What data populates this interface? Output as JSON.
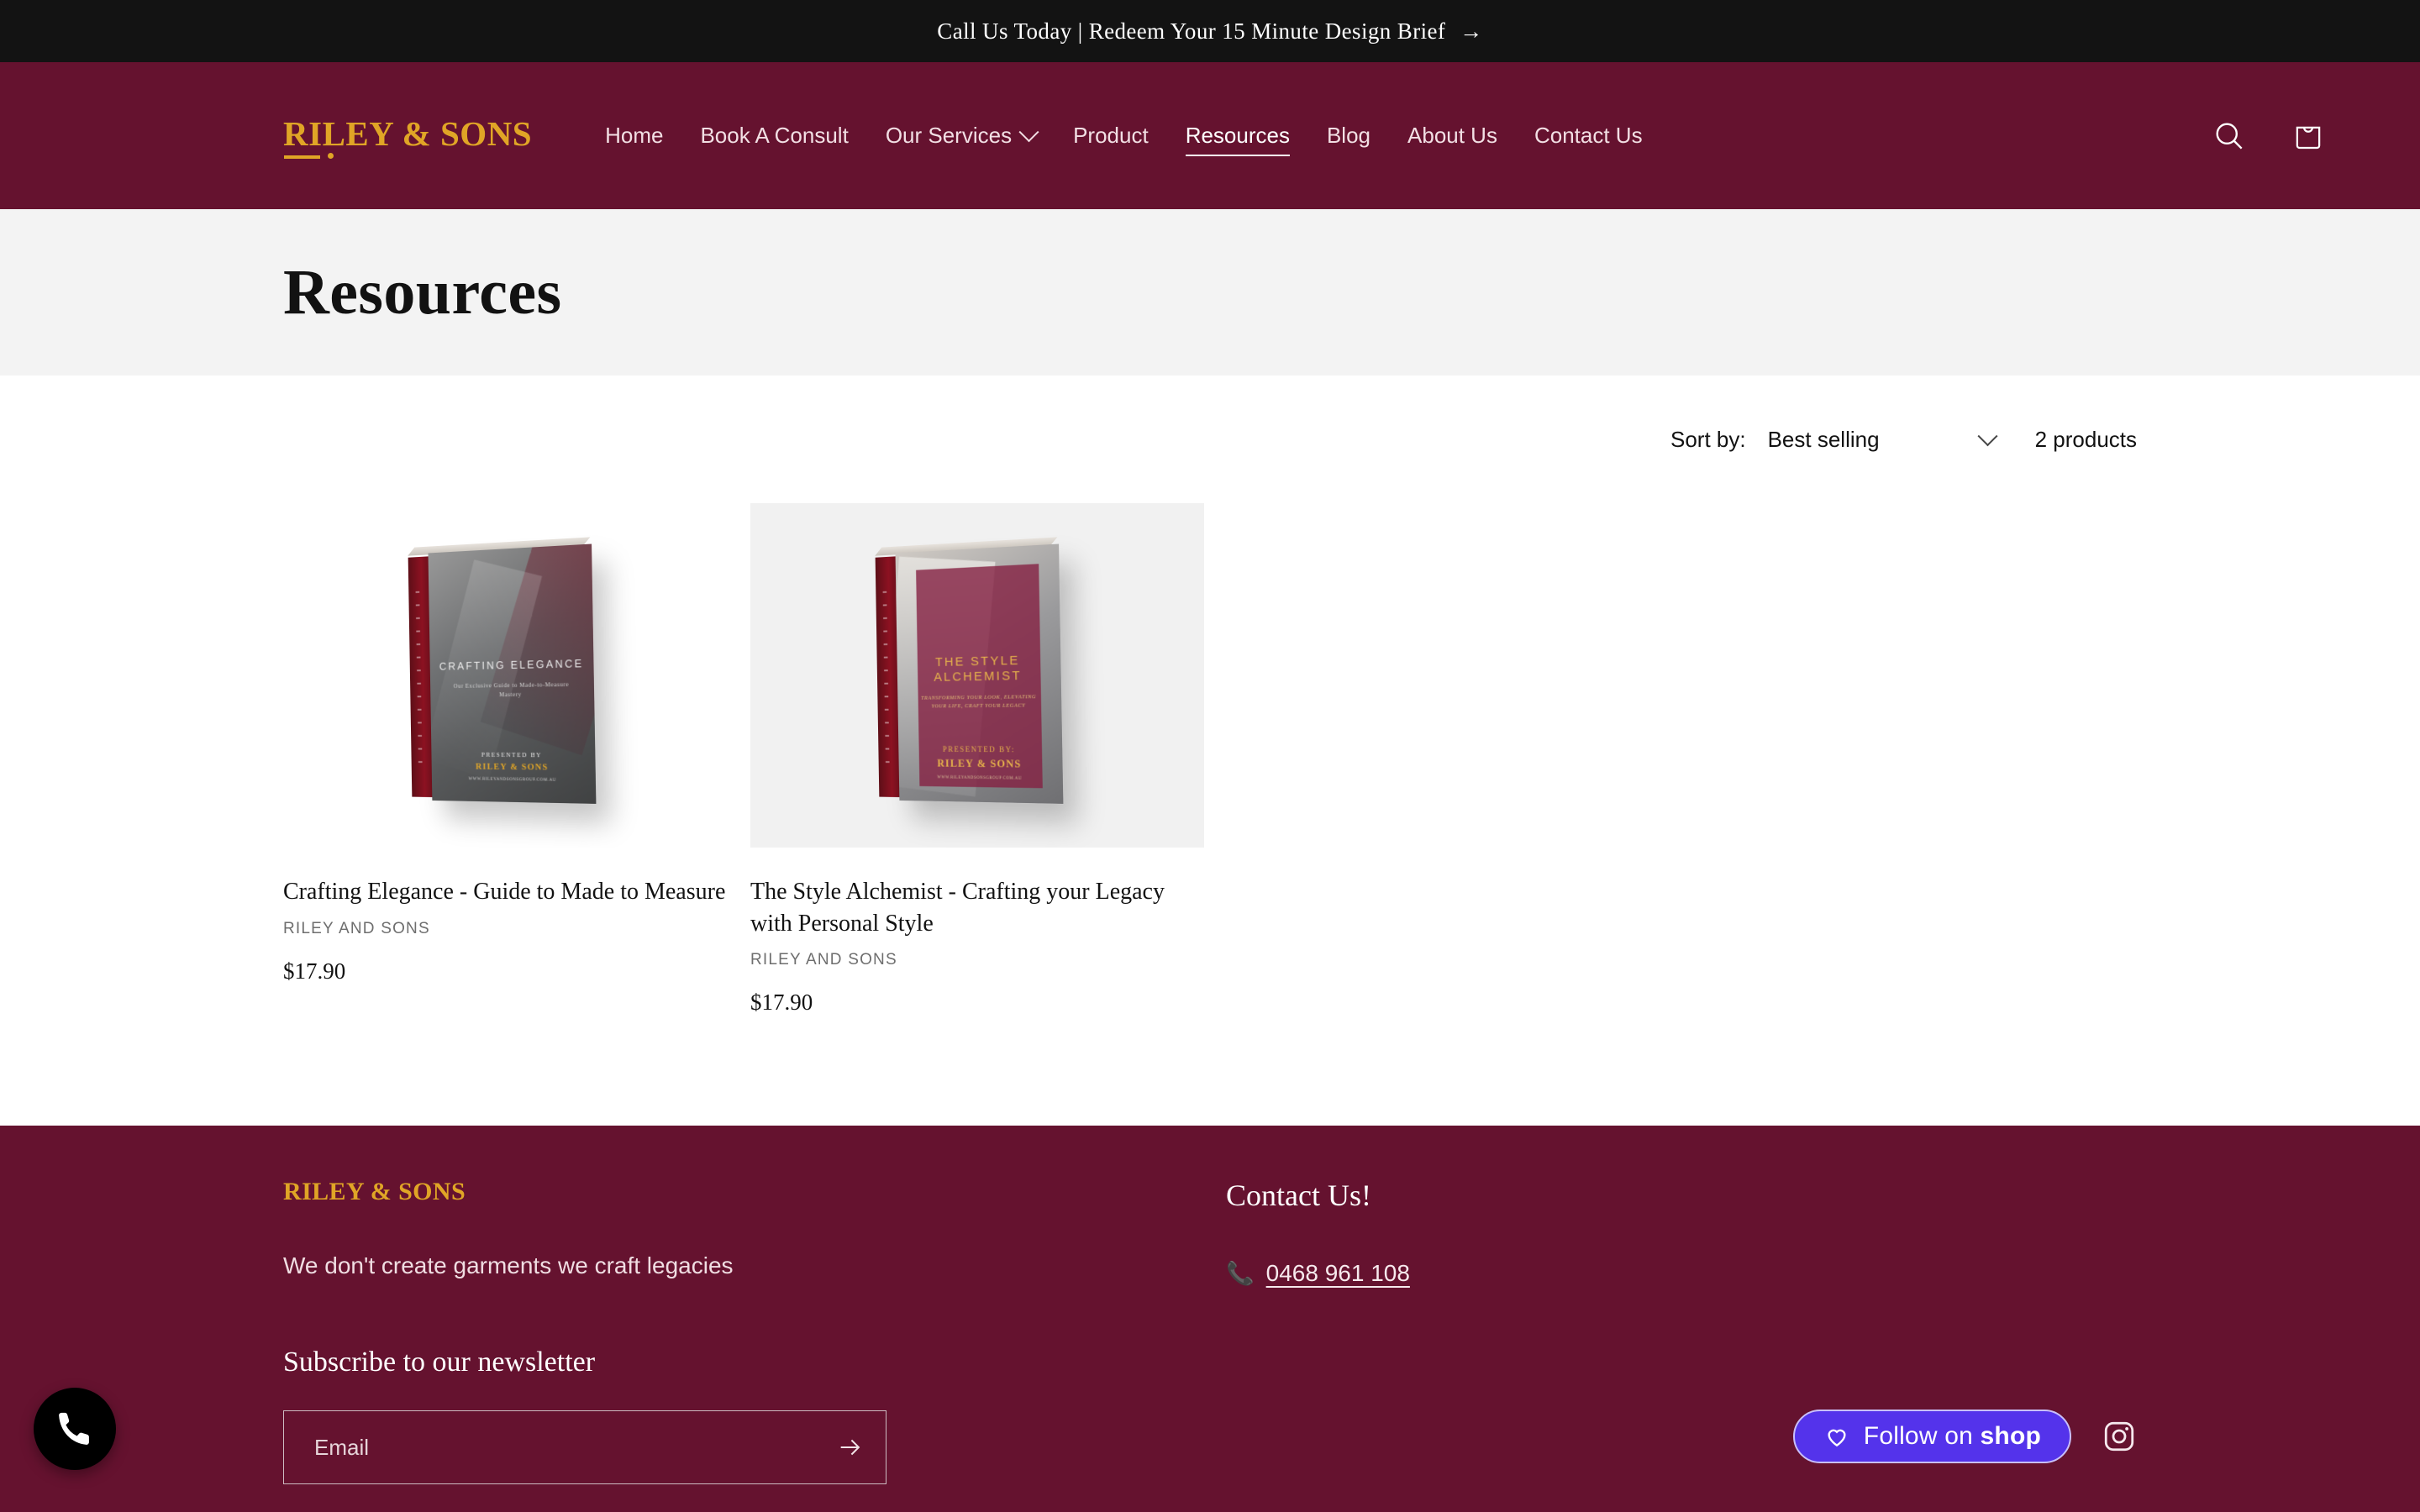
{
  "announcement": {
    "text": "Call Us Today | Redeem Your 15 Minute Design Brief",
    "arrow": "→"
  },
  "header": {
    "logo": "RILEY & SONS",
    "nav": [
      {
        "label": "Home",
        "has_chevron": false,
        "active": false
      },
      {
        "label": "Book A Consult",
        "has_chevron": false,
        "active": false
      },
      {
        "label": "Our Services",
        "has_chevron": true,
        "active": false
      },
      {
        "label": "Product",
        "has_chevron": false,
        "active": false
      },
      {
        "label": "Resources",
        "has_chevron": false,
        "active": true
      },
      {
        "label": "Blog",
        "has_chevron": false,
        "active": false
      },
      {
        "label": "About Us",
        "has_chevron": false,
        "active": false
      },
      {
        "label": "Contact Us",
        "has_chevron": false,
        "active": false
      }
    ],
    "search_icon": "search-icon",
    "cart_icon": "cart-bag-icon",
    "background_color": "#65122f",
    "accent_gold": "#e0a526"
  },
  "page": {
    "title": "Resources",
    "band_color": "#f3f3f3"
  },
  "toolbar": {
    "sort_label": "Sort by:",
    "sort_value": "Best selling",
    "product_count": "2 products"
  },
  "products": [
    {
      "title": "Crafting Elegance - Guide to Made to Measure",
      "vendor": "RILEY AND SONS",
      "price": "$17.90",
      "cover": {
        "title": "CRAFTING ELEGANCE",
        "subtitle": "Our Exclusive Guide to Made-to-Measure Mastery",
        "presented": "PRESENTED BY",
        "brand": "RILEY & SONS",
        "url": "WWW.RILEYANDSONSGROUP.COM.AU"
      }
    },
    {
      "title": "The Style Alchemist - Crafting your Legacy with Personal Style",
      "vendor": "RILEY AND SONS",
      "price": "$17.90",
      "cover": {
        "title": "THE STYLE ALCHEMIST",
        "subtitle": "TRANSFORMING YOUR LOOK, ELEVATING YOUR LIFE, CRAFT YOUR LEGACY",
        "presented": "PRESENTED BY:",
        "brand": "RILEY & SONS",
        "url": "WWW.RILEYANDSONSGROUP.COM.AU"
      }
    }
  ],
  "footer": {
    "logo": "RILEY & SONS",
    "tagline": "We don't create garments we craft legacies",
    "newsletter_heading": "Subscribe to our newsletter",
    "email_placeholder": "Email",
    "email_value": "",
    "contact_heading": "Contact Us!",
    "phone_icon": "📞",
    "phone": "0468 961 108",
    "shop_button": "Follow on ",
    "shop_button_word": "shop",
    "instagram_icon": "instagram-icon",
    "background_color": "#65122f",
    "shop_button_color": "#5433eb"
  },
  "floating": {
    "phone_button": "phone-icon"
  }
}
